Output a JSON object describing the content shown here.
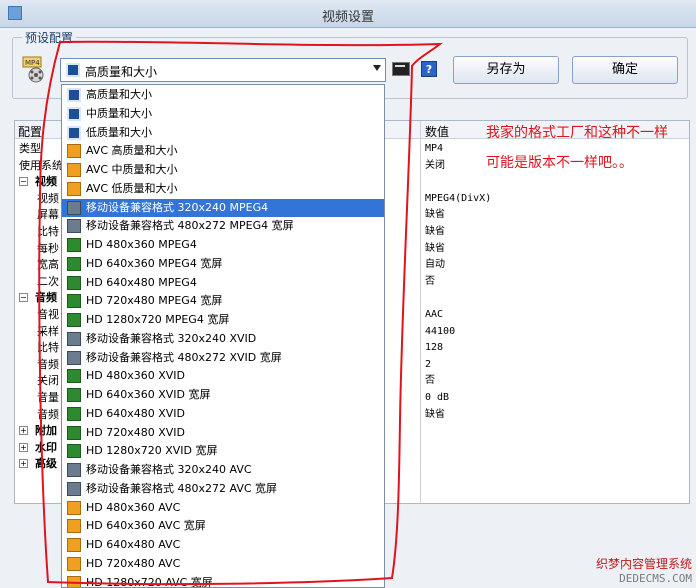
{
  "window": {
    "title": "视频设置"
  },
  "preset": {
    "group_label": "预设配置",
    "icon_text": "MP4",
    "combo_value": "高质量和大小",
    "save_as_label": "另存为",
    "ok_label": "确定",
    "help_label": "?"
  },
  "grid": {
    "col_name": "配置",
    "col_value": "数值",
    "rows": [
      {
        "name": "类型",
        "value": "MP4",
        "kind": "top"
      },
      {
        "name": "使用系统",
        "value": "关闭",
        "kind": "top"
      },
      {
        "name": "视频",
        "value": "",
        "kind": "cat",
        "exp": "−"
      },
      {
        "name": "视频",
        "value": "MPEG4(DivX)",
        "kind": "sub"
      },
      {
        "name": "屏幕",
        "value": "缺省",
        "kind": "sub"
      },
      {
        "name": "比特",
        "value": "缺省",
        "kind": "sub"
      },
      {
        "name": "每秒",
        "value": "缺省",
        "kind": "sub"
      },
      {
        "name": "宽高",
        "value": "自动",
        "kind": "sub"
      },
      {
        "name": "二次",
        "value": "否",
        "kind": "sub"
      },
      {
        "name": "音频",
        "value": "",
        "kind": "cat",
        "exp": "−"
      },
      {
        "name": "音视",
        "value": "AAC",
        "kind": "sub"
      },
      {
        "name": "采样",
        "value": "44100",
        "kind": "sub"
      },
      {
        "name": "比特",
        "value": "128",
        "kind": "sub"
      },
      {
        "name": "音频",
        "value": "2",
        "kind": "sub"
      },
      {
        "name": "关闭",
        "value": "否",
        "kind": "sub"
      },
      {
        "name": "音量",
        "value": "0 dB",
        "kind": "sub"
      },
      {
        "name": "音频",
        "value": "缺省",
        "kind": "sub"
      },
      {
        "name": "附加",
        "value": "",
        "kind": "cat",
        "exp": "+"
      },
      {
        "name": "水印",
        "value": "",
        "kind": "cat",
        "exp": "+"
      },
      {
        "name": "高级",
        "value": "",
        "kind": "cat",
        "exp": "+"
      }
    ]
  },
  "dropdown": {
    "selected_index": 6,
    "items": [
      {
        "label": "高质量和大小",
        "icon": "q"
      },
      {
        "label": "中质量和大小",
        "icon": "q"
      },
      {
        "label": "低质量和大小",
        "icon": "q"
      },
      {
        "label": "AVC 高质量和大小",
        "icon": "avc"
      },
      {
        "label": "AVC 中质量和大小",
        "icon": "avc"
      },
      {
        "label": "AVC 低质量和大小",
        "icon": "avc"
      },
      {
        "label": "移动设备兼容格式 320x240 MPEG4",
        "icon": "mob"
      },
      {
        "label": "移动设备兼容格式 480x272 MPEG4 宽屏",
        "icon": "mob"
      },
      {
        "label": "HD 480x360 MPEG4",
        "icon": "hd"
      },
      {
        "label": "HD 640x360 MPEG4 宽屏",
        "icon": "hd"
      },
      {
        "label": "HD 640x480 MPEG4",
        "icon": "hd"
      },
      {
        "label": "HD 720x480 MPEG4 宽屏",
        "icon": "hd"
      },
      {
        "label": "HD 1280x720 MPEG4 宽屏",
        "icon": "hd"
      },
      {
        "label": "移动设备兼容格式 320x240 XVID",
        "icon": "mob"
      },
      {
        "label": "移动设备兼容格式 480x272 XVID 宽屏",
        "icon": "mob"
      },
      {
        "label": "HD 480x360 XVID",
        "icon": "hd"
      },
      {
        "label": "HD 640x360 XVID 宽屏",
        "icon": "hd"
      },
      {
        "label": "HD 640x480 XVID",
        "icon": "hd"
      },
      {
        "label": "HD 720x480 XVID",
        "icon": "hd"
      },
      {
        "label": "HD 1280x720 XVID 宽屏",
        "icon": "hd"
      },
      {
        "label": "移动设备兼容格式 320x240 AVC",
        "icon": "mob"
      },
      {
        "label": "移动设备兼容格式 480x272 AVC 宽屏",
        "icon": "mob"
      },
      {
        "label": "HD 480x360 AVC",
        "icon": "avc"
      },
      {
        "label": "HD 640x360 AVC 宽屏",
        "icon": "avc"
      },
      {
        "label": "HD 640x480 AVC",
        "icon": "avc"
      },
      {
        "label": "HD 720x480 AVC",
        "icon": "avc"
      },
      {
        "label": "HD 1280x720 AVC 宽屏",
        "icon": "avc"
      }
    ]
  },
  "annotation": {
    "line1": "我家的格式工厂和这种不一样",
    "line2": "可能是版本不一样吧。。",
    "color": "#e0141e"
  },
  "watermark": {
    "line1": "织梦内容管理系统",
    "line2": "DEDECMS.COM"
  }
}
